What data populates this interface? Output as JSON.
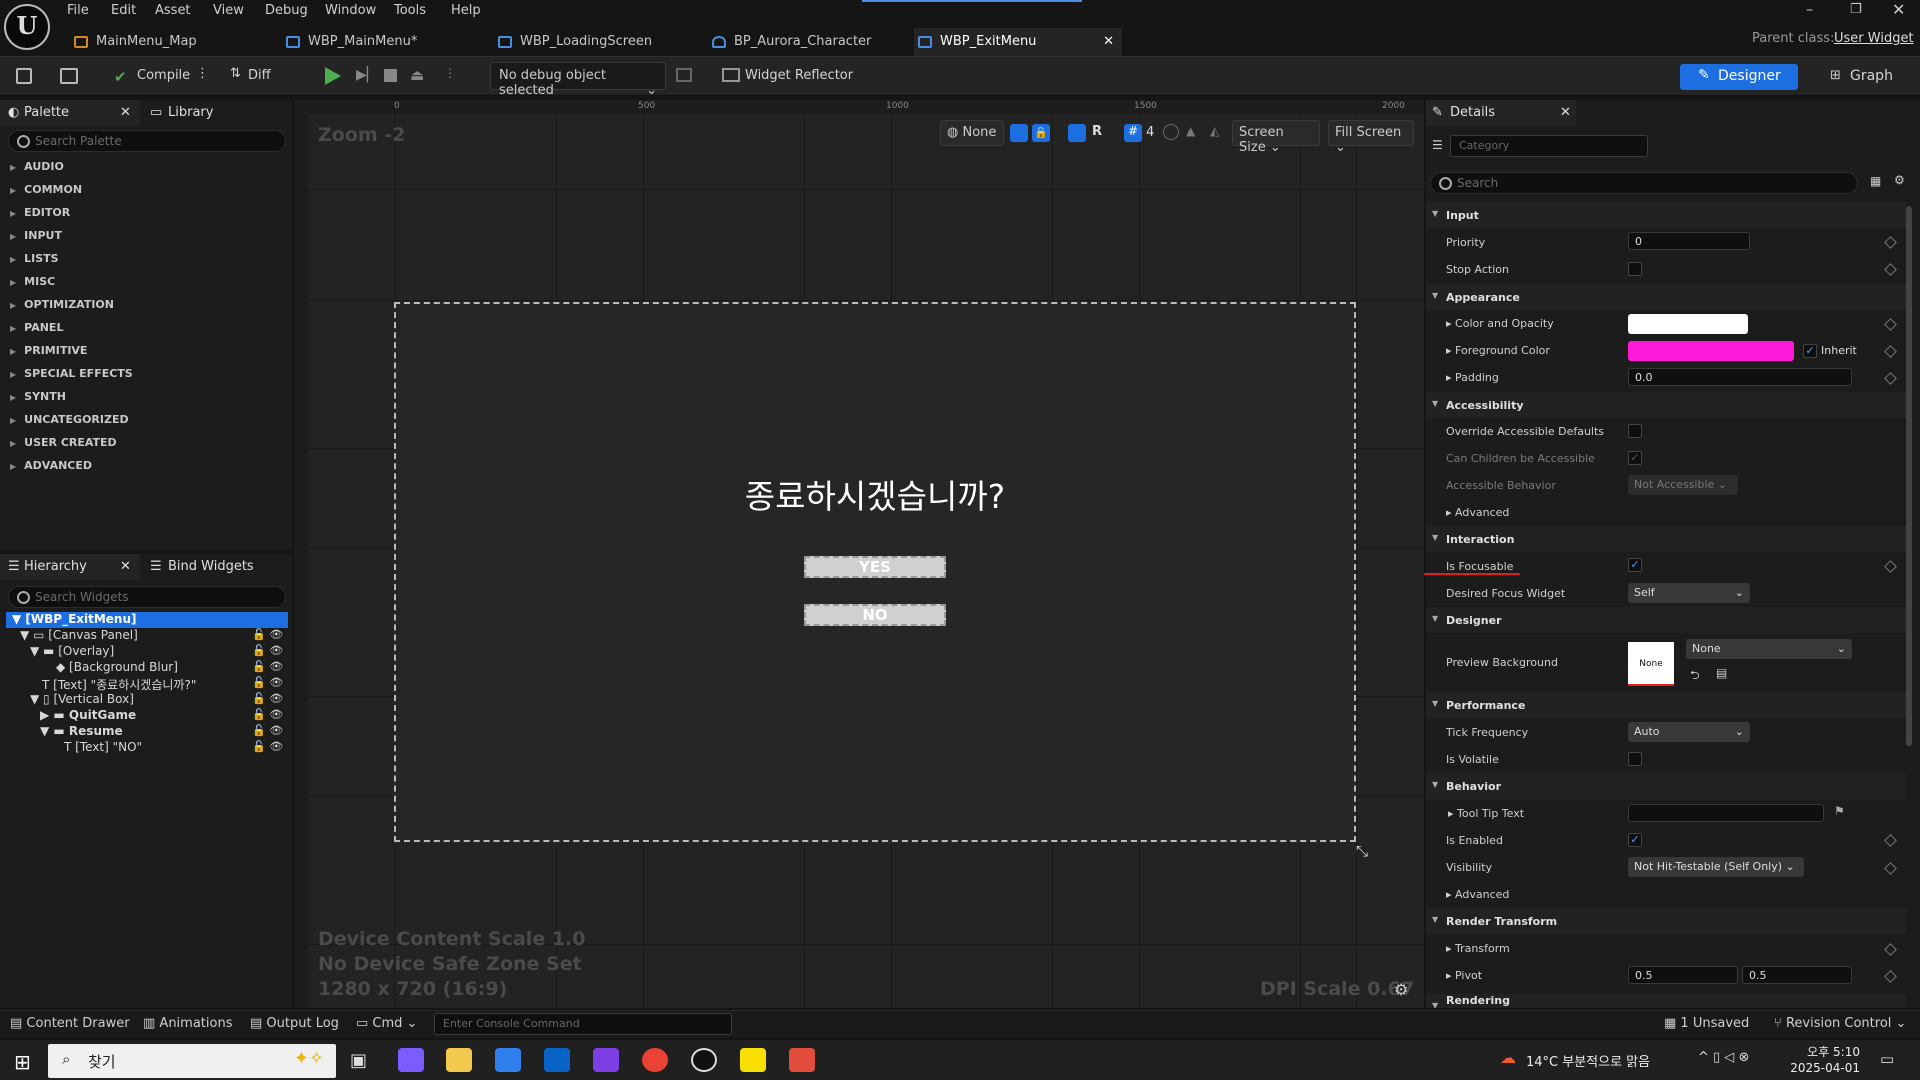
{
  "menu": [
    "File",
    "Edit",
    "Asset",
    "View",
    "Debug",
    "Window",
    "Tools",
    "Help"
  ],
  "tabs": [
    {
      "label": "MainMenu_Map"
    },
    {
      "label": "WBP_MainMenu*"
    },
    {
      "label": "WBP_LoadingScreen"
    },
    {
      "label": "BP_Aurora_Character"
    },
    {
      "label": "WBP_ExitMenu"
    }
  ],
  "parent_class": {
    "label": "Parent class:",
    "value": "User Widget"
  },
  "toolbar": {
    "compile": "Compile",
    "diff": "Diff",
    "debug": "No debug object selected",
    "reflector": "Widget Reflector",
    "designer": "Designer",
    "graph": "Graph"
  },
  "palette": {
    "title": "Palette",
    "library": "Library",
    "search": "Search Palette",
    "categories": [
      "AUDIO",
      "COMMON",
      "EDITOR",
      "INPUT",
      "LISTS",
      "MISC",
      "OPTIMIZATION",
      "PANEL",
      "PRIMITIVE",
      "SPECIAL EFFECTS",
      "SYNTH",
      "UNCATEGORIZED",
      "USER CREATED",
      "ADVANCED"
    ]
  },
  "hierarchy": {
    "title": "Hierarchy",
    "bind": "Bind Widgets",
    "search": "Search Widgets",
    "items": [
      "[WBP_ExitMenu]",
      "[Canvas Panel]",
      "[Overlay]",
      "[Background Blur]",
      "[Text] \"종료하시겠습니까?\"",
      "[Vertical Box]",
      "QuitGame",
      "Resume",
      "[Text] \"NO\""
    ]
  },
  "viewport": {
    "zoom": "Zoom -2",
    "none": "None",
    "r": "R",
    "grid": "4",
    "screen_size": "Screen Size",
    "fill_screen": "Fill Screen",
    "ruler": [
      "0",
      "500",
      "1000",
      "1500",
      "2000"
    ],
    "device_scale": "Device Content Scale 1.0",
    "safe_zone": "No Device Safe Zone Set",
    "resolution": "1280 x 720 (16:9)",
    "dpi": "DPI Scale 0.67"
  },
  "widget": {
    "title": "종료하시겠습니까?",
    "yes": "YES",
    "no": "NO"
  },
  "details": {
    "title": "Details",
    "category": "Category",
    "search": "Search",
    "sections": {
      "input": "Input",
      "appearance": "Appearance",
      "accessibility": "Accessibility",
      "interaction": "Interaction",
      "designer": "Designer",
      "performance": "Performance",
      "behavior": "Behavior",
      "render": "Render Transform",
      "rendering": "Rendering"
    },
    "props": {
      "priority": "Priority",
      "priority_val": "0",
      "stop_action": "Stop Action",
      "color_opacity": "Color and Opacity",
      "foreground": "Foreground Color",
      "inherit": "Inherit",
      "padding": "Padding",
      "padding_val": "0.0",
      "override": "Override Accessible Defaults",
      "children": "Can Children be Accessible",
      "acc_behavior": "Accessible Behavior",
      "acc_val": "Not Accessible",
      "advanced": "Advanced",
      "focusable": "Is Focusable",
      "desired_focus": "Desired Focus Widget",
      "desired_val": "Self",
      "preview_bg": "Preview Background",
      "preview_none": "None",
      "preview_dd": "None",
      "tick": "Tick Frequency",
      "tick_val": "Auto",
      "volatile": "Is Volatile",
      "tooltip": "Tool Tip Text",
      "enabled": "Is Enabled",
      "visibility": "Visibility",
      "visibility_val": "Not Hit-Testable (Self Only)",
      "advanced2": "Advanced",
      "transform": "Transform",
      "pivot": "Pivot",
      "pivot_x": "0.5",
      "pivot_y": "0.5"
    },
    "colors": {
      "white": "#ffffff",
      "magenta": "#ff1ad9"
    }
  },
  "status": {
    "content_drawer": "Content Drawer",
    "animations": "Animations",
    "output_log": "Output Log",
    "cmd": "Cmd",
    "console": "Enter Console Command",
    "unsaved": "1 Unsaved",
    "revision": "Revision Control"
  },
  "taskbar": {
    "search": "찾기",
    "weather": "14°C  부분적으로 맑음",
    "time": "오후 5:10",
    "date": "2025-04-01"
  }
}
